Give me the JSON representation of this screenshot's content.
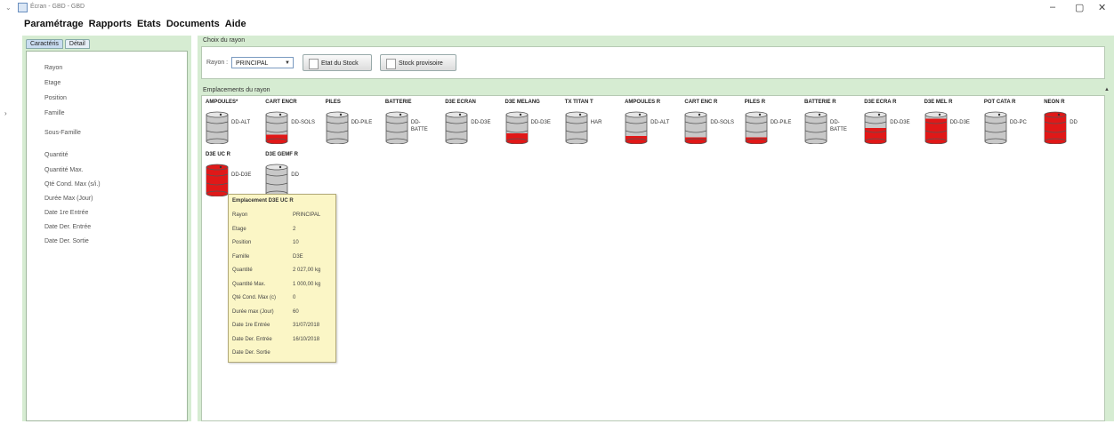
{
  "window": {
    "title": "Écran - GBD - GBD",
    "minimize": "–",
    "maximize": "▢",
    "close": "✕"
  },
  "menu": [
    "Paramétrage",
    "Rapports",
    "Etats",
    "Documents",
    "Aide"
  ],
  "left_panel": {
    "tabs": [
      "Caractéris",
      "Détail"
    ],
    "fields": [
      "Rayon",
      "Etage",
      "Position",
      "Famille",
      "Sous-Famille",
      "Quantité",
      "Quantité Max.",
      "Qté Cond. Max (s/i.)",
      "Durée Max (Jour)",
      "Date 1re Entrée",
      "Date Der. Entrée",
      "Date Der. Sortie"
    ]
  },
  "choix": {
    "label": "Choix du rayon",
    "rayon_label": "Rayon :",
    "rayon_value": "PRINCIPAL",
    "btn_etat": "Etat du Stock",
    "btn_stock": "Stock provisoire"
  },
  "emplacements": {
    "label": "Emplacements du rayon",
    "items": [
      {
        "title": "AMPOULES*",
        "code": "DD-ALT",
        "fill": 0.0
      },
      {
        "title": "CART ENCR",
        "code": "DD-SOLS",
        "fill": 0.25
      },
      {
        "title": "PILES",
        "code": "DD-PILE",
        "fill": 0.0
      },
      {
        "title": "BATTERIE",
        "code": "DD-BATTE",
        "fill": 0.0
      },
      {
        "title": "D3E ECRAN",
        "code": "DD-D3E",
        "fill": 0.0
      },
      {
        "title": "D3E MELANG",
        "code": "DD-D3E",
        "fill": 0.3
      },
      {
        "title": "TX TITAN T",
        "code": "HAR",
        "fill": 0.0
      },
      {
        "title": "AMPOULES R",
        "code": "DD-ALT",
        "fill": 0.2
      },
      {
        "title": "CART ENC R",
        "code": "DD-SOLS",
        "fill": 0.15
      },
      {
        "title": "PILES R",
        "code": "DD-PILE",
        "fill": 0.15
      },
      {
        "title": "BATTERIE R",
        "code": "DD-BATTE",
        "fill": 0.0
      },
      {
        "title": "D3E ECRA R",
        "code": "DD-D3E",
        "fill": 0.5
      },
      {
        "title": "D3E MEL R",
        "code": "DD-D3E",
        "fill": 0.85
      },
      {
        "title": "POT CATA R",
        "code": "DD-PC",
        "fill": 0.0
      },
      {
        "title": "NEON R",
        "code": "DD",
        "fill": 1.0
      },
      {
        "title": "D3E UC R",
        "code": "DD-D3E",
        "fill": 1.0
      },
      {
        "title": "D3E GEMF R",
        "code": "DD",
        "fill": 0.0
      }
    ]
  },
  "tooltip": {
    "title": "Emplacement D3E UC R",
    "rows": [
      {
        "k": "Rayon",
        "v": "PRINCIPAL"
      },
      {
        "k": "Etage",
        "v": "2"
      },
      {
        "k": "Position",
        "v": "10"
      },
      {
        "k": "Famille",
        "v": "D3E"
      },
      {
        "k": "Quantité",
        "v": "2 027,00 kg"
      },
      {
        "k": "Quantité Max.",
        "v": "1 000,00 kg"
      },
      {
        "k": "Qté Cond. Max (c)",
        "v": "0"
      },
      {
        "k": "Durée max (Jour)",
        "v": "60"
      },
      {
        "k": "Date 1re Entrée",
        "v": "31/07/2018"
      },
      {
        "k": "Date Der. Entrée",
        "v": "16/10/2018"
      },
      {
        "k": "Date Der. Sortie",
        "v": ""
      }
    ]
  },
  "colors": {
    "fill": "#e01818",
    "barrel": "#c8c8c8",
    "panel": "#d6ecd2",
    "tooltip": "#fbf6c6"
  }
}
